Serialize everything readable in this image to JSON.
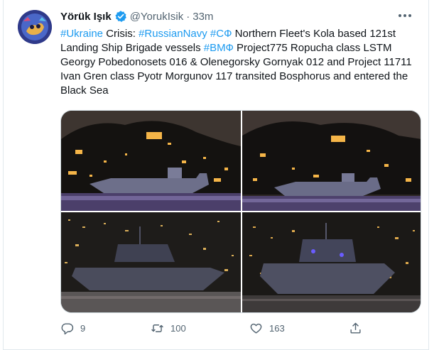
{
  "tweet": {
    "author_name": "Yörük Işık",
    "author_handle": "@YorukIsik",
    "separator": "·",
    "time": "33m",
    "segments": [
      {
        "text": "#Ukraine",
        "kind": "tag"
      },
      {
        "text": " Crisis: ",
        "kind": "plain"
      },
      {
        "text": "#RussianNavy",
        "kind": "tag"
      },
      {
        "text": " ",
        "kind": "plain"
      },
      {
        "text": "#СФ",
        "kind": "tag"
      },
      {
        "text": " Northern Fleet's Kola based 121st Landing Ship Brigade vessels ",
        "kind": "plain"
      },
      {
        "text": "#ВМФ",
        "kind": "tag"
      },
      {
        "text": " Project775 Ropucha class LSTM Georgy Pobedonosets 016 & Olenegorsky Gornyak 012 and Project 11711 Ivan Gren class Pyotr Morgunov 117 transited Bosphorus and entered the Black Sea",
        "kind": "plain"
      }
    ]
  },
  "photos": [
    {
      "name": "photo-ship-night-1",
      "icon": "night-ship-photo"
    },
    {
      "name": "photo-ship-night-2",
      "icon": "night-ship-photo"
    },
    {
      "name": "photo-ship-night-3",
      "icon": "night-ship-photo"
    },
    {
      "name": "photo-ship-night-4",
      "icon": "night-ship-photo"
    }
  ],
  "actions": {
    "reply_count": "9",
    "retweet_count": "100",
    "like_count": "163",
    "share_icon": "share-icon"
  },
  "colors": {
    "link": "#1d9bf0",
    "secondary": "#536471",
    "verified": "#1d9bf0"
  }
}
